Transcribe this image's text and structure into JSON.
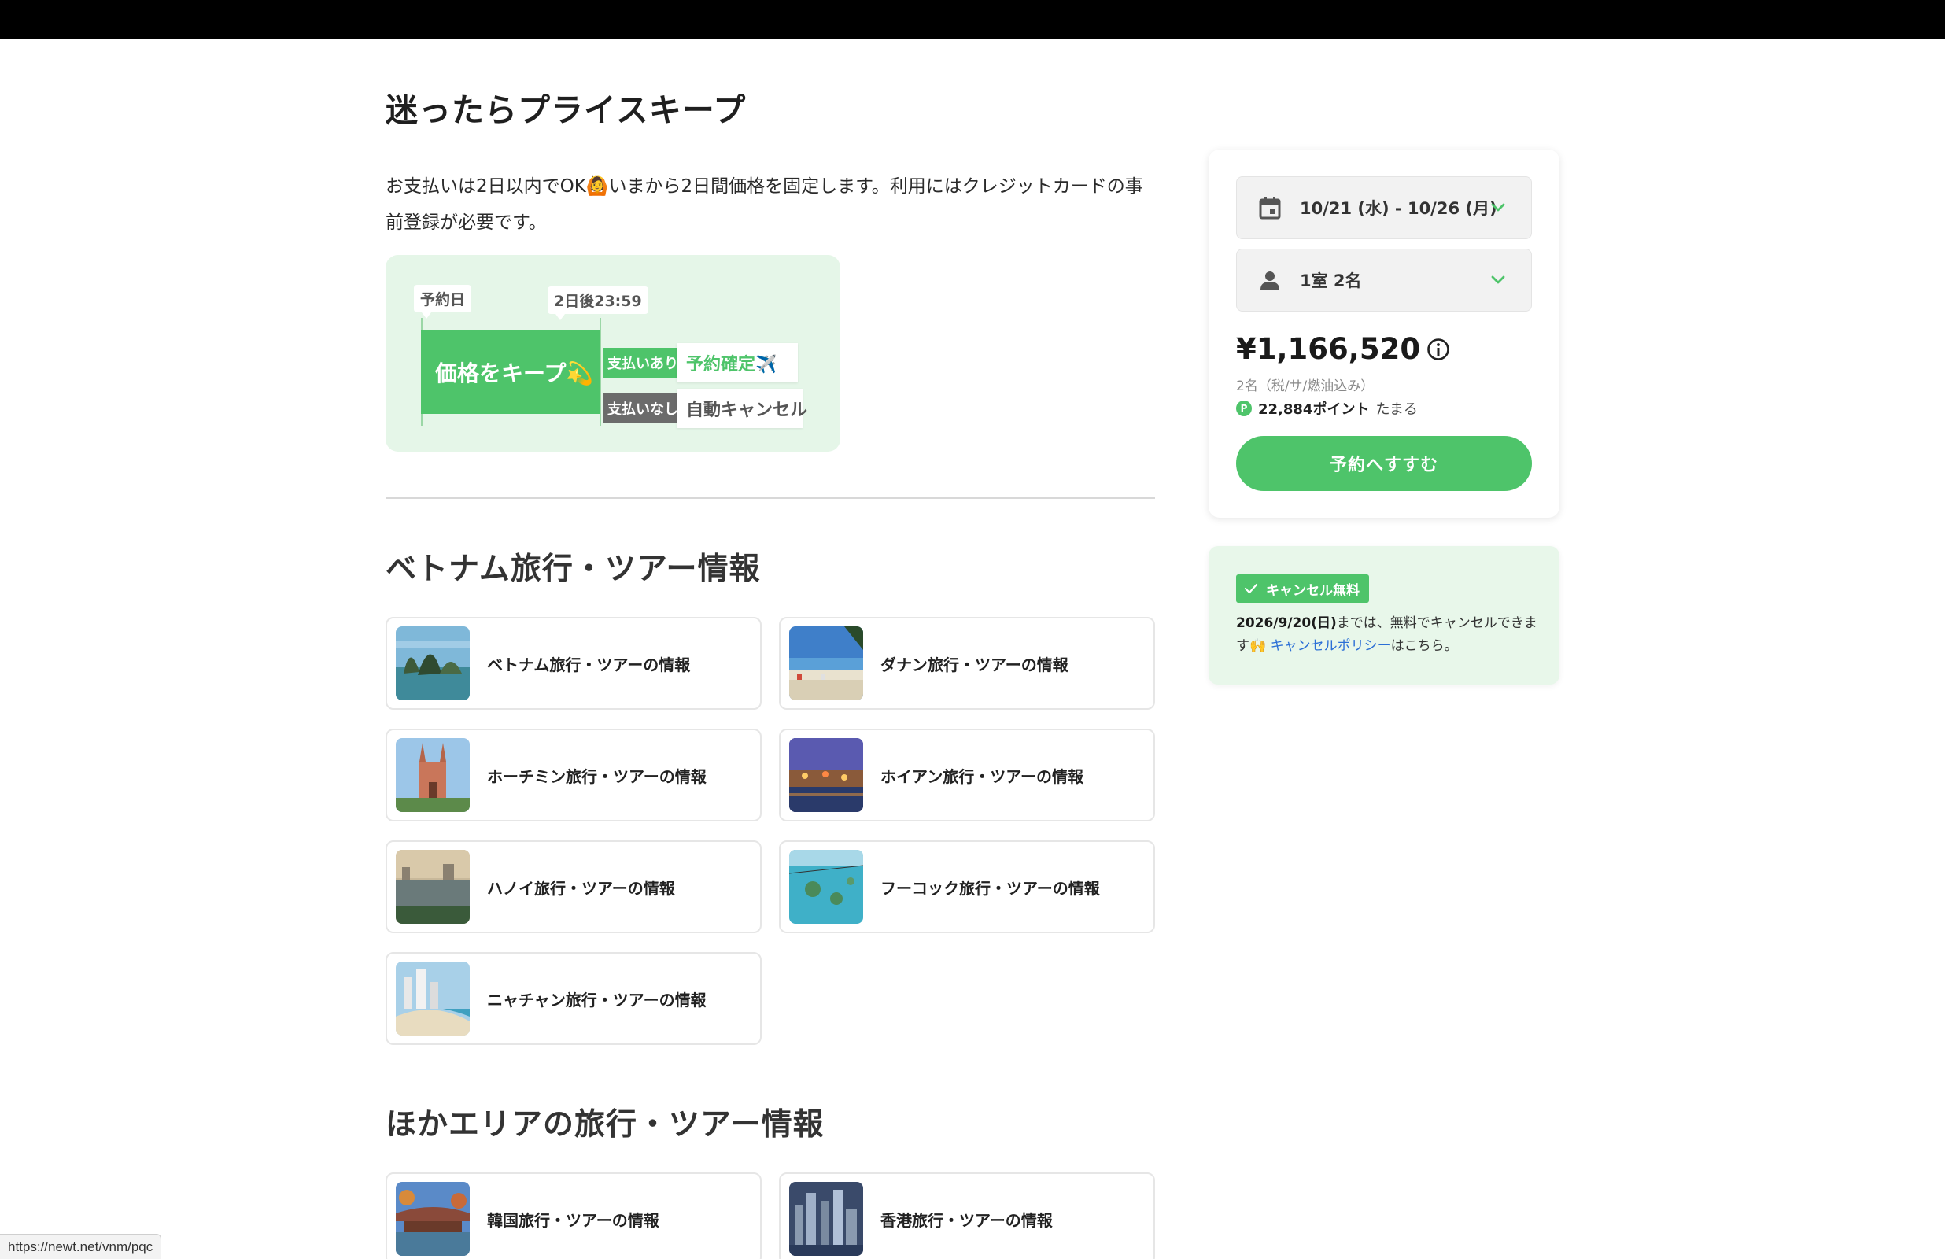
{
  "keep": {
    "title": "迷ったらプライスキープ",
    "description": "お支払いは2日以内でOK🙆いまから2日間価格を固定します。利用にはクレジットカードの事前登録が必要です。",
    "diagram": {
      "tag_date": "予約日",
      "tag_deadline": "2日後23:59",
      "keep_label": "価格をキープ💫",
      "pay_label": "支払いあり",
      "nopay_label": "支払いなし",
      "confirmed": "予約確定✈️",
      "auto_cancel": "自動キャンセル"
    }
  },
  "vietnam_section": {
    "title": "ベトナム旅行・ツアー情報",
    "items": [
      {
        "label": "ベトナム旅行・ツアーの情報"
      },
      {
        "label": "ダナン旅行・ツアーの情報"
      },
      {
        "label": "ホーチミン旅行・ツアーの情報"
      },
      {
        "label": "ホイアン旅行・ツアーの情報"
      },
      {
        "label": "ハノイ旅行・ツアーの情報"
      },
      {
        "label": "フーコック旅行・ツアーの情報"
      },
      {
        "label": "ニャチャン旅行・ツアーの情報"
      }
    ]
  },
  "other_section": {
    "title": "ほかエリアの旅行・ツアー情報",
    "items": [
      {
        "label": "韓国旅行・ツアーの情報"
      },
      {
        "label": "香港旅行・ツアーの情報"
      }
    ]
  },
  "booking": {
    "date_range": "10/21 (水) - 10/26 (月)",
    "guests": "1室 2名",
    "price": "¥1,166,520",
    "price_note": "2名（税/サ/燃油込み）",
    "points_icon": "P",
    "points": "22,884ポイント",
    "points_suffix": "たまる",
    "book_button": "予約へすすむ",
    "icons": {
      "date": "calendar-icon",
      "guests": "person-icon",
      "chevron": "chevron-down-icon",
      "info": "info-icon"
    },
    "accent_color": "#4ec46a"
  },
  "cancellation": {
    "badge": "キャンセル無料",
    "deadline": "2026/9/20(日)",
    "text_before_link": "までは、無料でキャンセルできます🙌 ",
    "link": "キャンセルポリシー",
    "text_after_link": "はこちら。"
  },
  "status_bar": {
    "url": "https://newt.net/vnm/pqc"
  }
}
